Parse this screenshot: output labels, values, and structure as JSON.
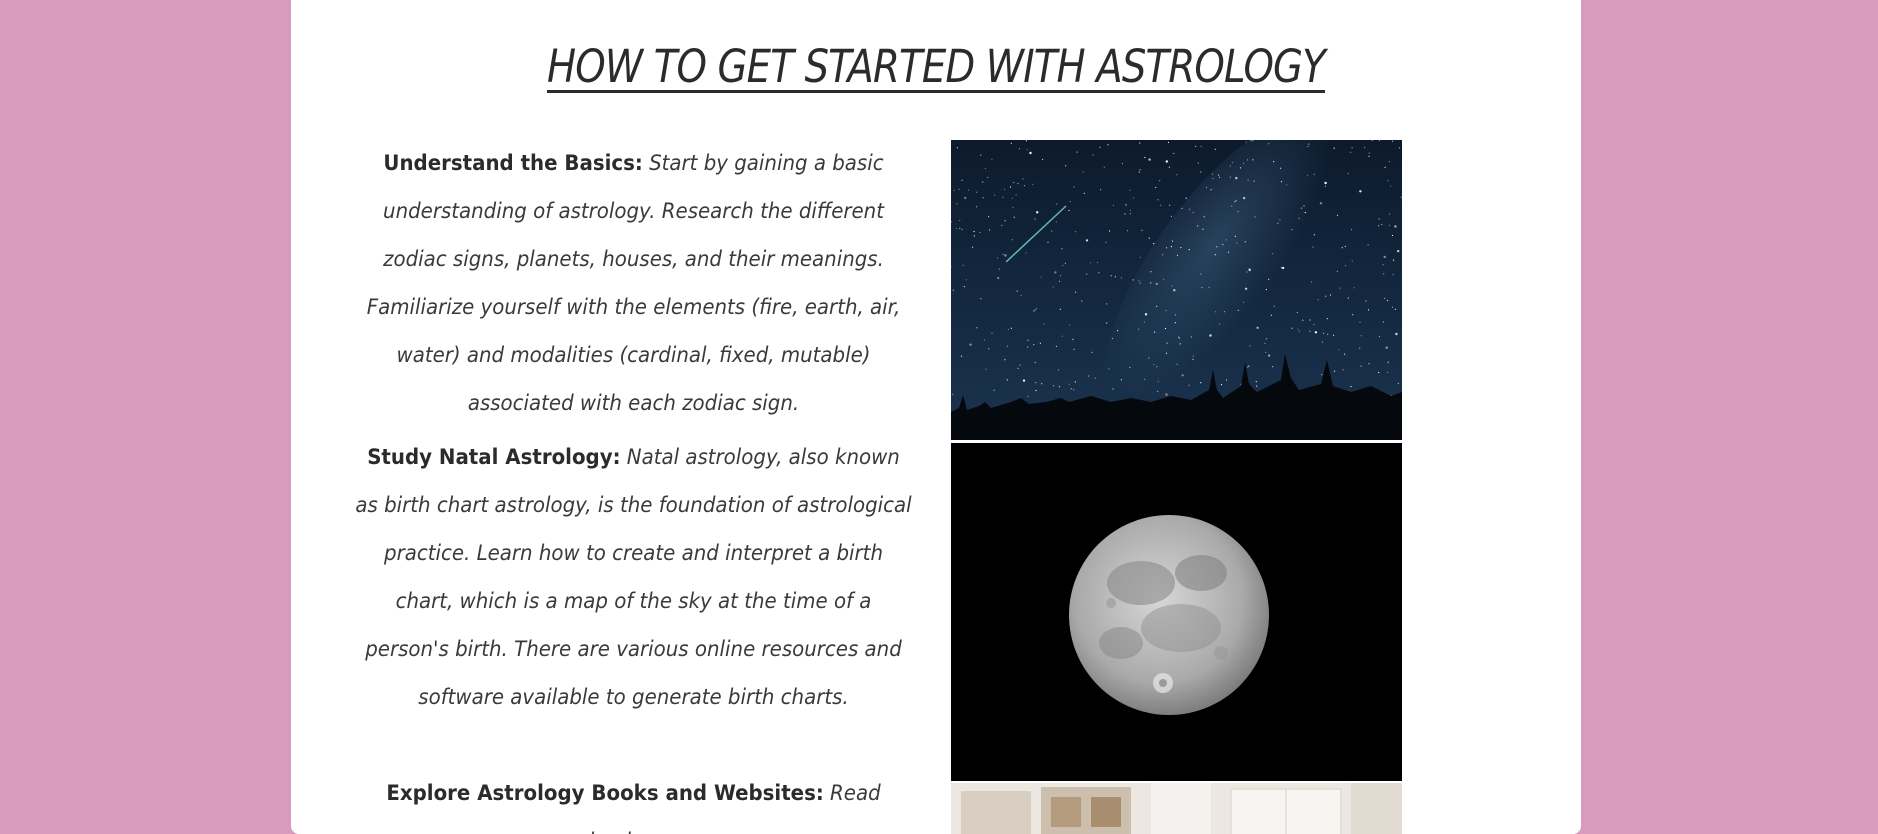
{
  "page": {
    "title": "HOW TO GET STARTED WITH ASTROLOGY"
  },
  "sections": [
    {
      "heading": "Understand the Basics:",
      "body": " Start by gaining a basic understanding of astrology. Research the different zodiac signs, planets, houses, and their meanings. Familiarize yourself with the elements (fire, earth, air, water) and modalities (cardinal, fixed, mutable) associated with each zodiac sign."
    },
    {
      "heading": "Study Natal Astrology:",
      "body": " Natal astrology, also known as birth chart astrology, is the foundation of astrological practice. Learn how to create and interpret a birth chart, which is a map of the sky at the time of a person's birth. There are various online resources and software available to generate birth charts."
    },
    {
      "heading": "Explore Astrology Books and Websites:",
      "body": " Read books on"
    }
  ],
  "images": [
    {
      "name": "starry-night-sky"
    },
    {
      "name": "full-moon"
    },
    {
      "name": "bright-room"
    }
  ],
  "colors": {
    "background": "#d99bbd",
    "card": "#ffffff",
    "text": "#2b2b2b"
  }
}
